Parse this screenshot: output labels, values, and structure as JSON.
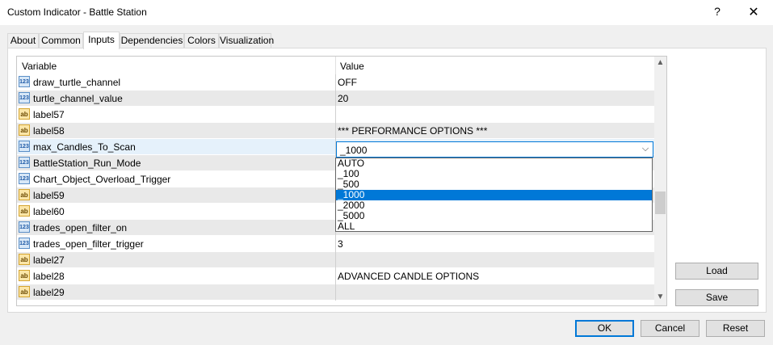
{
  "window": {
    "title": "Custom Indicator - Battle Station",
    "help_glyph": "?",
    "close_glyph": "✕"
  },
  "tabs": [
    {
      "label": "About"
    },
    {
      "label": "Common"
    },
    {
      "label": "Inputs",
      "active": true
    },
    {
      "label": "Dependencies"
    },
    {
      "label": "Colors"
    },
    {
      "label": "Visualization"
    }
  ],
  "grid": {
    "columns": {
      "variable": "Variable",
      "value": "Value"
    },
    "rows": [
      {
        "type": "num",
        "name": "draw_turtle_channel",
        "value": "OFF"
      },
      {
        "type": "num",
        "name": "turtle_channel_value",
        "value": "20"
      },
      {
        "type": "txt",
        "name": "label57",
        "value": ""
      },
      {
        "type": "txt",
        "name": "label58",
        "value": "*** PERFORMANCE OPTIONS ***"
      },
      {
        "type": "num",
        "name": "max_Candles_To_Scan",
        "value": ""
      },
      {
        "type": "num",
        "name": "BattleStation_Run_Mode",
        "value": ""
      },
      {
        "type": "num",
        "name": "Chart_Object_Overload_Trigger",
        "value": ""
      },
      {
        "type": "txt",
        "name": "label59",
        "value": ""
      },
      {
        "type": "txt",
        "name": "label60",
        "value": ""
      },
      {
        "type": "num",
        "name": "trades_open_filter_on",
        "value": ""
      },
      {
        "type": "num",
        "name": "trades_open_filter_trigger",
        "value": "3"
      },
      {
        "type": "txt",
        "name": "label27",
        "value": ""
      },
      {
        "type": "txt",
        "name": "label28",
        "value": "   ADVANCED CANDLE OPTIONS"
      },
      {
        "type": "txt",
        "name": "label29",
        "value": ""
      }
    ],
    "icon_text": {
      "num": "123",
      "txt": "ab"
    }
  },
  "combo": {
    "value": "_1000",
    "arrow": "⌵"
  },
  "dropdown": {
    "options": [
      "AUTO",
      "_100",
      "_500",
      "_1000",
      "_2000",
      "_5000",
      "ALL"
    ],
    "selected_index": 3
  },
  "scrollbar": {
    "up": "▲",
    "down": "▼"
  },
  "side_buttons": {
    "load": "Load",
    "save": "Save"
  },
  "footer_buttons": {
    "ok": "OK",
    "cancel": "Cancel",
    "reset": "Reset"
  }
}
